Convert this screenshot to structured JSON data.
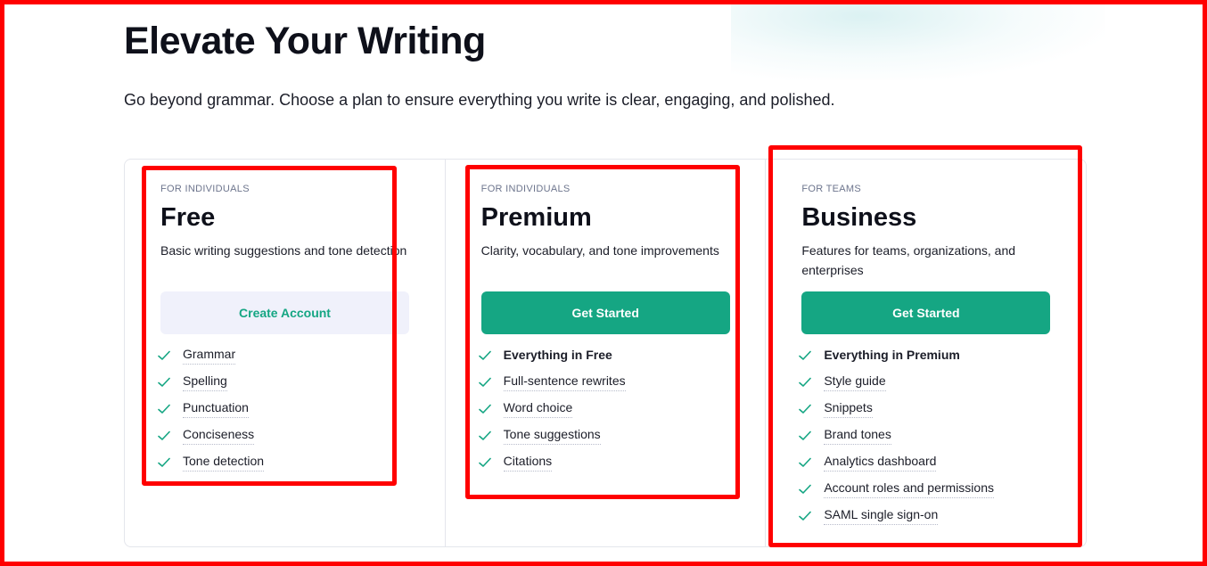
{
  "header": {
    "title": "Elevate Your Writing",
    "subtitle": "Go beyond grammar. Choose a plan to ensure everything you write is clear, engaging, and polished."
  },
  "colors": {
    "accent": "#15a683",
    "secondary_button_bg": "#f0f1fb",
    "highlight_box": "#ff0000",
    "title": "#0e101a",
    "muted": "#6d758d"
  },
  "icons": {
    "feature_check": "check-icon"
  },
  "plans": [
    {
      "audience": "FOR INDIVIDUALS",
      "name": "Free",
      "description": "Basic writing suggestions and tone detection",
      "cta": "Create Account",
      "cta_style": "secondary",
      "features": [
        {
          "label": "Grammar",
          "bold": false
        },
        {
          "label": "Spelling",
          "bold": false
        },
        {
          "label": "Punctuation",
          "bold": false
        },
        {
          "label": "Conciseness",
          "bold": false
        },
        {
          "label": "Tone detection",
          "bold": false
        }
      ]
    },
    {
      "audience": "FOR INDIVIDUALS",
      "name": "Premium",
      "description": "Clarity, vocabulary, and tone improvements",
      "cta": "Get Started",
      "cta_style": "primary",
      "features": [
        {
          "label": "Everything in Free",
          "bold": true
        },
        {
          "label": "Full-sentence rewrites",
          "bold": false
        },
        {
          "label": "Word choice",
          "bold": false
        },
        {
          "label": "Tone suggestions",
          "bold": false
        },
        {
          "label": "Citations",
          "bold": false
        }
      ]
    },
    {
      "audience": "FOR TEAMS",
      "name": "Business",
      "description": "Features for teams, organizations, and enterprises",
      "cta": "Get Started",
      "cta_style": "primary",
      "features": [
        {
          "label": "Everything in Premium",
          "bold": true
        },
        {
          "label": "Style guide",
          "bold": false
        },
        {
          "label": "Snippets",
          "bold": false
        },
        {
          "label": "Brand tones",
          "bold": false
        },
        {
          "label": "Analytics dashboard",
          "bold": false
        },
        {
          "label": "Account roles and permissions",
          "bold": false
        },
        {
          "label": "SAML single sign-on",
          "bold": false
        }
      ]
    }
  ]
}
